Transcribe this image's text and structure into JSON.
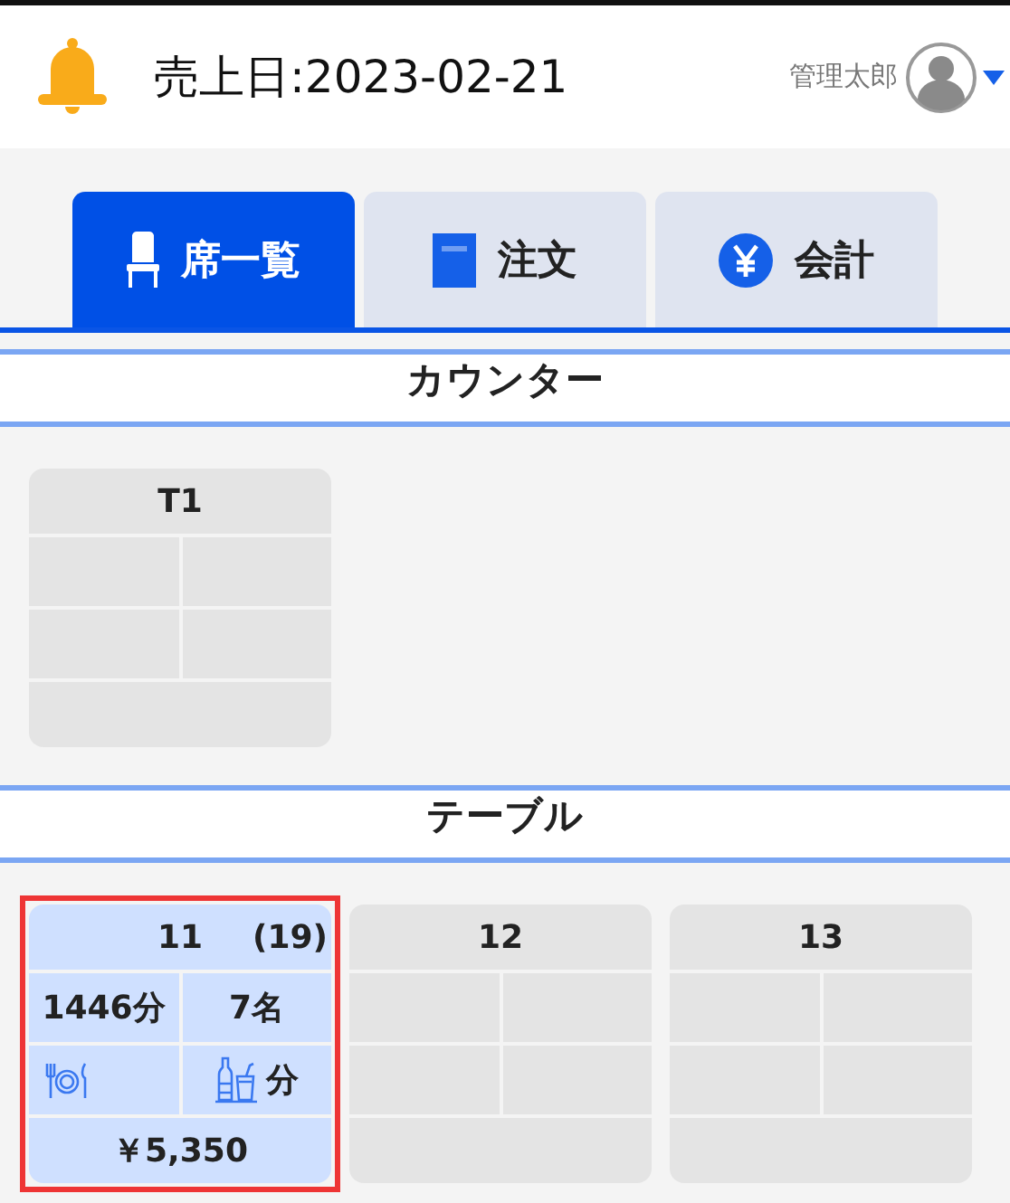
{
  "header": {
    "sales_date": "売上日:2023-02-21",
    "user_name": "管理太郎"
  },
  "tabs": [
    {
      "label": "席一覧",
      "kind": "seats",
      "selected": true
    },
    {
      "label": "注文",
      "kind": "order",
      "selected": false
    },
    {
      "label": "会計",
      "kind": "checkout",
      "selected": false
    }
  ],
  "sections": [
    {
      "title": "カウンター",
      "tables": [
        {
          "name": "T1",
          "occupied": false,
          "selected": false
        }
      ]
    },
    {
      "title": "テーブル",
      "tables": [
        {
          "name": "11",
          "count": "(19)",
          "elapsed": "1446分",
          "guests": "7名",
          "drink_time": "分",
          "amount": "￥5,350",
          "occupied": true,
          "selected": true
        },
        {
          "name": "12",
          "occupied": false,
          "selected": false
        },
        {
          "name": "13",
          "occupied": false,
          "selected": false
        }
      ]
    }
  ]
}
